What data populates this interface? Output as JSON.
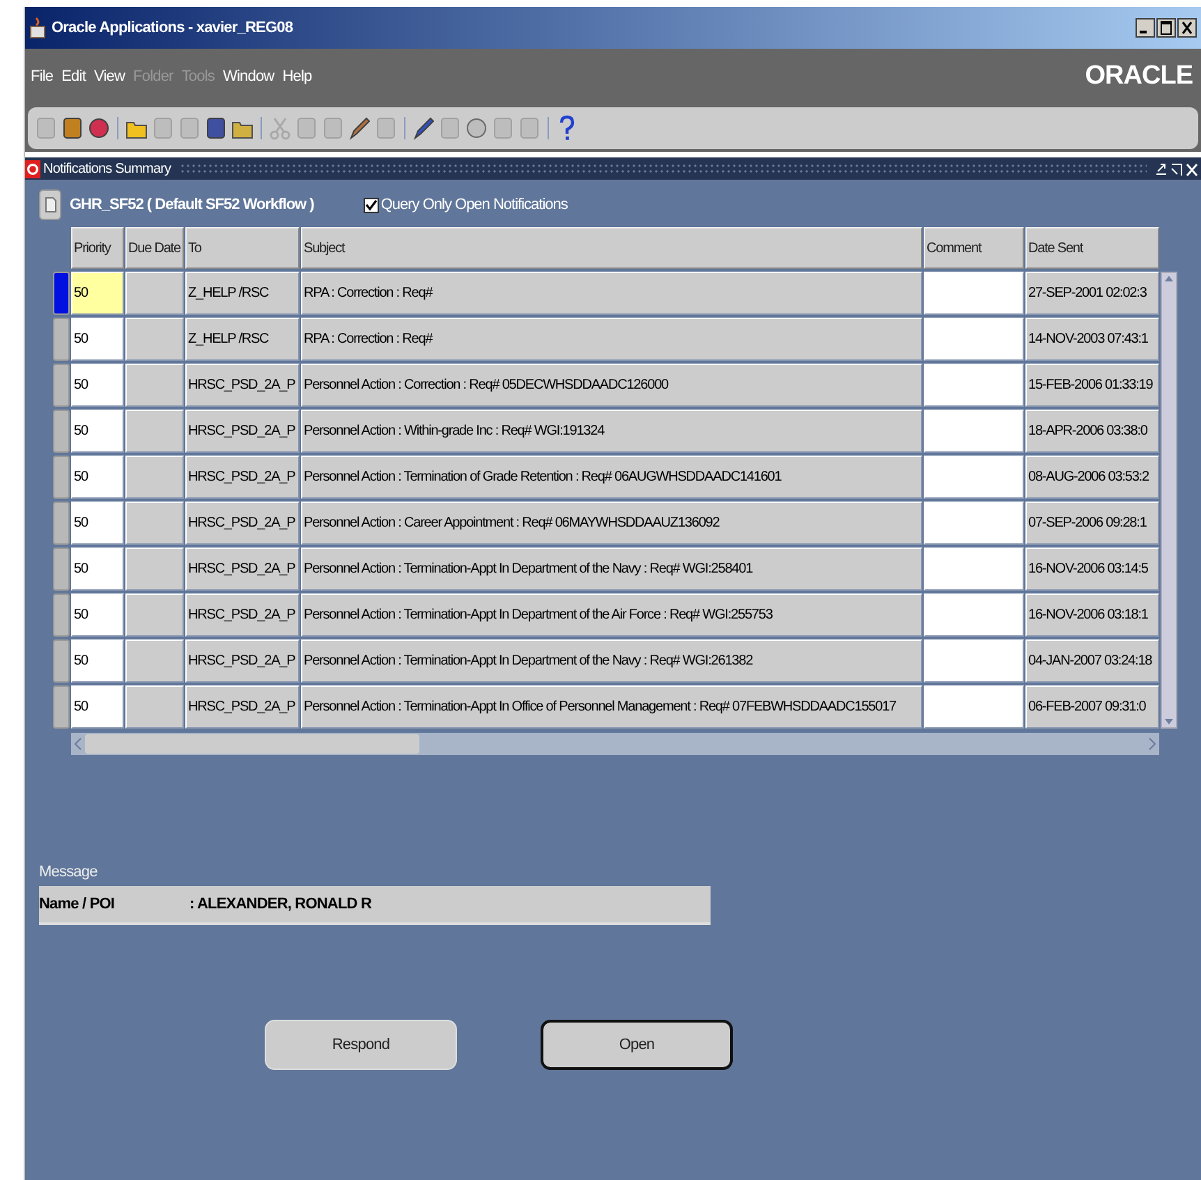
{
  "window": {
    "title": "Oracle Applications - xavier_REG08"
  },
  "menu": [
    {
      "label": "File",
      "disabled": false
    },
    {
      "label": "Edit",
      "disabled": false
    },
    {
      "label": "View",
      "disabled": false
    },
    {
      "label": "Folder",
      "disabled": true
    },
    {
      "label": "Tools",
      "disabled": true
    },
    {
      "label": "Window",
      "disabled": false
    },
    {
      "label": "Help",
      "disabled": false
    }
  ],
  "logo": "ORACLE",
  "toolbar": [
    {
      "kind": "button",
      "disabled": true
    },
    {
      "kind": "button",
      "disabled": false
    },
    {
      "kind": "button",
      "disabled": false
    },
    {
      "kind": "separator"
    },
    {
      "kind": "button",
      "disabled": false
    },
    {
      "kind": "button",
      "disabled": true
    },
    {
      "kind": "button",
      "disabled": true
    },
    {
      "kind": "button",
      "disabled": false
    },
    {
      "kind": "button",
      "disabled": false
    },
    {
      "kind": "separator"
    },
    {
      "kind": "button",
      "disabled": true
    },
    {
      "kind": "button",
      "disabled": true
    },
    {
      "kind": "button",
      "disabled": true
    },
    {
      "kind": "button",
      "disabled": false
    },
    {
      "kind": "button",
      "disabled": true
    },
    {
      "kind": "separator"
    },
    {
      "kind": "button",
      "disabled": false
    },
    {
      "kind": "button",
      "disabled": true
    },
    {
      "kind": "button",
      "disabled": true
    },
    {
      "kind": "button",
      "disabled": true
    },
    {
      "kind": "button",
      "disabled": true
    },
    {
      "kind": "separator"
    },
    {
      "kind": "button",
      "disabled": false
    }
  ],
  "form": {
    "title": "Notifications Summary"
  },
  "header": {
    "workflow": "GHR_SF52 ( Default SF52 Workflow )",
    "filter": {
      "label": "Query Only Open Notifications",
      "checked": true
    }
  },
  "table": {
    "columns": [
      "Priority",
      "Due Date",
      "To",
      "Subject",
      "Comment",
      "Date Sent"
    ],
    "rows": [
      {
        "selected": true,
        "priority": "50",
        "to": "Z_HELP /RSC",
        "subject": "RPA : Correction : Req#",
        "date_sent": "27-SEP-2001 02:02:3"
      },
      {
        "selected": false,
        "priority": "50",
        "to": "Z_HELP /RSC",
        "subject": "RPA : Correction : Req#",
        "date_sent": "14-NOV-2003 07:43:1"
      },
      {
        "selected": false,
        "priority": "50",
        "to": "HRSC_PSD_2A_P",
        "subject": "Personnel Action : Correction : Req# 05DECWHSDDAADC126000",
        "date_sent": "15-FEB-2006 01:33:19"
      },
      {
        "selected": false,
        "priority": "50",
        "to": "HRSC_PSD_2A_P",
        "subject": "Personnel Action : Within-grade Inc : Req# WGI:191324",
        "date_sent": "18-APR-2006 03:38:0"
      },
      {
        "selected": false,
        "priority": "50",
        "to": "HRSC_PSD_2A_P",
        "subject": "Personnel Action : Termination of Grade Retention : Req# 06AUGWHSDDAADC141601",
        "date_sent": "08-AUG-2006 03:53:2"
      },
      {
        "selected": false,
        "priority": "50",
        "to": "HRSC_PSD_2A_P",
        "subject": "Personnel Action : Career Appointment : Req# 06MAYWHSDDAAUZ136092",
        "date_sent": "07-SEP-2006 09:28:1"
      },
      {
        "selected": false,
        "priority": "50",
        "to": "HRSC_PSD_2A_P",
        "subject": "Personnel Action : Termination-Appt In Department of the Navy : Req# WGI:258401",
        "date_sent": "16-NOV-2006 03:14:5"
      },
      {
        "selected": false,
        "priority": "50",
        "to": "HRSC_PSD_2A_P",
        "subject": "Personnel Action : Termination-Appt In Department of the Air Force : Req# WGI:255753",
        "date_sent": "16-NOV-2006 03:18:1"
      },
      {
        "selected": false,
        "priority": "50",
        "to": "HRSC_PSD_2A_P",
        "subject": "Personnel Action : Termination-Appt In Department of the Navy : Req# WGI:261382",
        "date_sent": "04-JAN-2007 03:24:18"
      },
      {
        "selected": false,
        "priority": "50",
        "to": "HRSC_PSD_2A_P",
        "subject": "Personnel Action : Termination-Appt In Office of Personnel Management : Req# 07FEBWHSDDAADC155017",
        "date_sent": "06-FEB-2007 09:31:0"
      }
    ]
  },
  "message": {
    "label": "Message",
    "name_label": "Name / POI",
    "name_value": ": ALEXANDER, RONALD R"
  },
  "buttons": [
    {
      "label": "Respond",
      "default": false
    },
    {
      "label": "Open",
      "default": true
    }
  ]
}
